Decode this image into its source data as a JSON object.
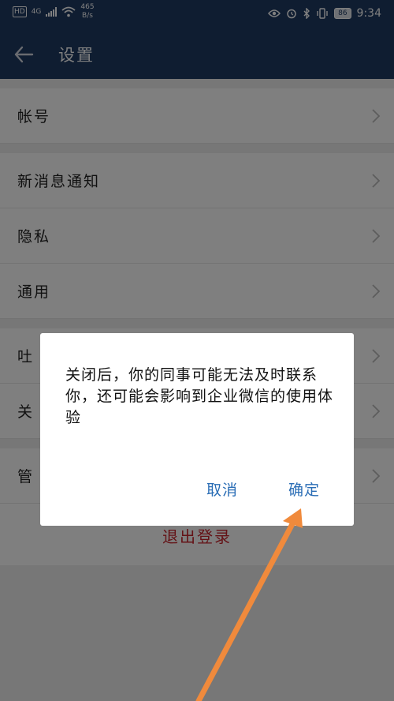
{
  "status_bar": {
    "hd": "HD",
    "network": "4G",
    "speed_value": "465",
    "speed_unit": "B/s",
    "battery": "86",
    "time": "9:34"
  },
  "app_bar": {
    "title": "设置"
  },
  "settings": {
    "account": "帐号",
    "notifications": "新消息通知",
    "privacy": "隐私",
    "general": "通用",
    "feedback": "吐",
    "about": "关",
    "manage": "管",
    "logout": "退出登录"
  },
  "dialog": {
    "message": "关闭后，你的同事可能无法及时联系你，还可能会影响到企业微信的使用体验",
    "cancel_label": "取消",
    "confirm_label": "确定"
  },
  "annotation": {
    "arrow_color": "#f08a3c"
  },
  "colors": {
    "app_bar": "#1e3a63",
    "button_text": "#2a6db5",
    "logout_text": "#c8242c"
  }
}
